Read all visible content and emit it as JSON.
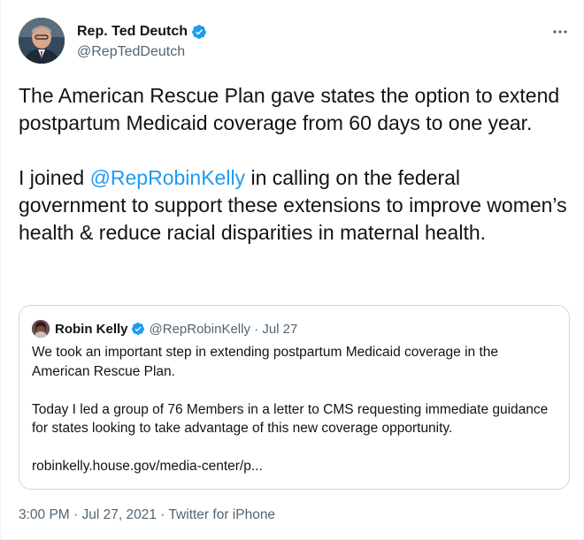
{
  "author": {
    "display_name": "Rep. Ted Deutch",
    "handle": "@RepTedDeutch"
  },
  "more_icon": "more-dots-icon",
  "tweet": {
    "line1": "The American Rescue Plan gave states the option to extend postpartum Medicaid coverage from 60 days to one year.",
    "line2_prefix": "I joined ",
    "mention": "@RepRobinKelly",
    "line2_suffix": " in calling on the federal government to support these extensions to improve women’s health & reduce racial disparities in maternal health."
  },
  "quote": {
    "display_name": "Robin Kelly",
    "handle": "@RepRobinKelly",
    "separator": "·",
    "date": "Jul 27",
    "paragraph1": "We took an important step in extending postpartum Medicaid coverage in the American Rescue Plan.",
    "paragraph2": "Today I led a group of 76 Members in a letter to CMS requesting immediate guidance for states looking to take advantage of this new coverage opportunity.",
    "link": "robinkelly.house.gov/media-center/p..."
  },
  "timestamp": "3:00 PM · Jul 27, 2021 · Twitter for iPhone",
  "colors": {
    "link": "#1d9bf0",
    "muted": "#536471",
    "text": "#0f1419",
    "verified": "#1d9bf0"
  }
}
